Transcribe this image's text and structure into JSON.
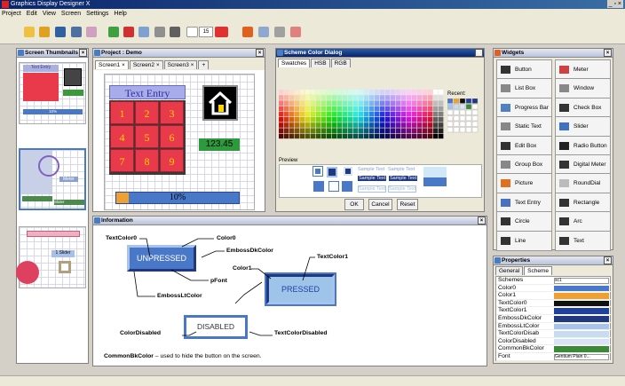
{
  "app": {
    "title": "Graphics Display Designer X",
    "window_controls": "_ ▫ ×"
  },
  "menu": [
    "Project",
    "Edit",
    "View",
    "Screen",
    "Settings",
    "Help"
  ],
  "toolbar": {
    "font_size": "15"
  },
  "thumbnails": {
    "title": "Screen Thumbnails",
    "thumb1_title": "Text Entry",
    "thumb1_pct": "10%",
    "thumb2_label1": "Meter",
    "thumb2_label2": "Slider",
    "thumb3_label": "1 Slider"
  },
  "project": {
    "title": "Project : Demo",
    "tabs": [
      "Screen1",
      "Screen2",
      "Screen3"
    ],
    "add_tab": "+",
    "text_entry": "Text Entry",
    "keys": [
      "1",
      "2",
      "3",
      "4",
      "5",
      "6",
      "7",
      "8",
      "9"
    ],
    "value": "123.45",
    "progress_label": "10%",
    "progress_value": 0.1
  },
  "scheme_dialog": {
    "title": "Scheme Color Dialog",
    "tabs": [
      "Swatches",
      "HSB",
      "RGB"
    ],
    "recent_label": "Recent:",
    "preview_label": "Preview",
    "sample": "Sample Text",
    "ok": "OK",
    "cancel": "Cancel",
    "reset": "Reset"
  },
  "widgets": {
    "title": "Widgets",
    "items": [
      {
        "label": "Button",
        "icon": "cursor-icon"
      },
      {
        "label": "Meter",
        "icon": "meter-icon"
      },
      {
        "label": "List Box",
        "icon": "list-icon"
      },
      {
        "label": "Window",
        "icon": "window-icon"
      },
      {
        "label": "Progress Bar",
        "icon": "progress-icon"
      },
      {
        "label": "Check Box",
        "icon": "checkmark-icon"
      },
      {
        "label": "Static Text",
        "icon": "static-text-icon"
      },
      {
        "label": "Slider",
        "icon": "slider-icon"
      },
      {
        "label": "Edit Box",
        "icon": "edit-box-icon"
      },
      {
        "label": "Radio Button",
        "icon": "radio-icon"
      },
      {
        "label": "Group Box",
        "icon": "group-box-icon"
      },
      {
        "label": "Digital Meter",
        "icon": "digital-meter-icon"
      },
      {
        "label": "Picture",
        "icon": "picture-icon"
      },
      {
        "label": "RoundDial",
        "icon": "dial-icon"
      },
      {
        "label": "Text Entry",
        "icon": "keypad-icon"
      },
      {
        "label": "Rectangle",
        "icon": "rectangle-icon"
      },
      {
        "label": "Circle",
        "icon": "circle-icon"
      },
      {
        "label": "Arc",
        "icon": "arc-icon"
      },
      {
        "label": "Line",
        "icon": "line-icon"
      },
      {
        "label": "Text",
        "icon": "text-icon"
      }
    ]
  },
  "properties": {
    "title": "Properties",
    "tabs": [
      "General",
      "Scheme"
    ],
    "rows": [
      {
        "name": "Schemes",
        "value": "sc1",
        "color": ""
      },
      {
        "name": "Color0",
        "value": "",
        "color": "#4a78c8"
      },
      {
        "name": "Color1",
        "value": "",
        "color": "#f0a030"
      },
      {
        "name": "TextColor0",
        "value": "",
        "color": "#101010"
      },
      {
        "name": "TextColor1",
        "value": "",
        "color": "#2040a0"
      },
      {
        "name": "EmbossDkColor",
        "value": "",
        "color": "#203880"
      },
      {
        "name": "EmbossLtColor",
        "value": "",
        "color": "#a8c4ec"
      },
      {
        "name": "TextColorDisab",
        "value": "",
        "color": "#c8dcf0"
      },
      {
        "name": "ColorDisabled",
        "value": "",
        "color": "#d8e4f4"
      },
      {
        "name": "CommonBkColor",
        "value": "",
        "color": "#3a8a3a"
      },
      {
        "name": "Font",
        "value": "Gentium Plain 0...",
        "color": ""
      }
    ]
  },
  "information": {
    "title": "Information",
    "unpressed": "UNPRESSED",
    "pressed": "PRESSED",
    "disabled": "DISABLED",
    "labels": {
      "textcolor0": "TextColor0",
      "color0": "Color0",
      "embossdk": "EmbossDkColor",
      "textcolor1": "TextColor1",
      "color1": "Color1",
      "pfont": "pFont",
      "embosslt": "EmbossLtColor",
      "colordisabled": "ColorDisabled",
      "textcolordisabled": "TextColorDisabled"
    },
    "note_bold": "CommonBkColor",
    "note_rest": " – used to hide the button on the screen."
  }
}
